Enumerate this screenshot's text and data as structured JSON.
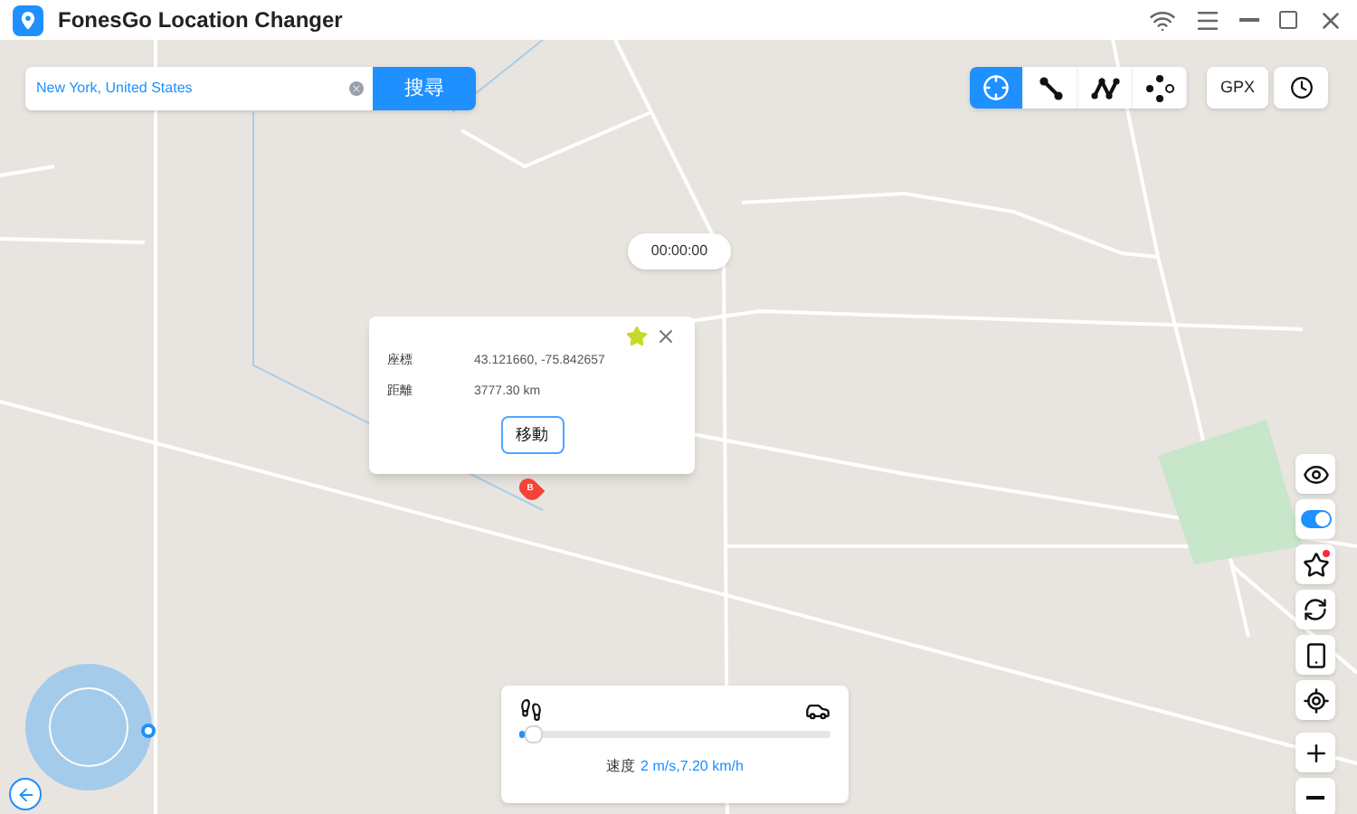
{
  "window": {
    "title": "FonesGo Location Changer"
  },
  "search": {
    "value": "New York, United States",
    "button": "搜尋"
  },
  "modes": [
    {
      "kind": "teleport",
      "selected": true
    },
    {
      "kind": "two-spot",
      "selected": false
    },
    {
      "kind": "multi-spot",
      "selected": false
    },
    {
      "kind": "joystick",
      "selected": false
    }
  ],
  "gpx_button": "GPX",
  "timer": "00:00:00",
  "popup": {
    "favorite": true,
    "rows": [
      {
        "label": "座標",
        "value": "43.121660, -75.842657"
      },
      {
        "label": "距離",
        "value": "3777.30 km"
      }
    ],
    "button": "移動"
  },
  "marker": "B",
  "speed": {
    "level": 0.02,
    "label": "速度",
    "value": "2 m/s,7.20 km/h"
  },
  "side_tools": [
    {
      "kind": "gaming"
    },
    {
      "kind": "toggle",
      "on": true
    },
    {
      "kind": "favorites",
      "notification": true
    },
    {
      "kind": "rotate"
    },
    {
      "kind": "device"
    },
    {
      "kind": "locate"
    },
    {
      "kind": "zoom-in"
    },
    {
      "kind": "zoom-out"
    }
  ]
}
